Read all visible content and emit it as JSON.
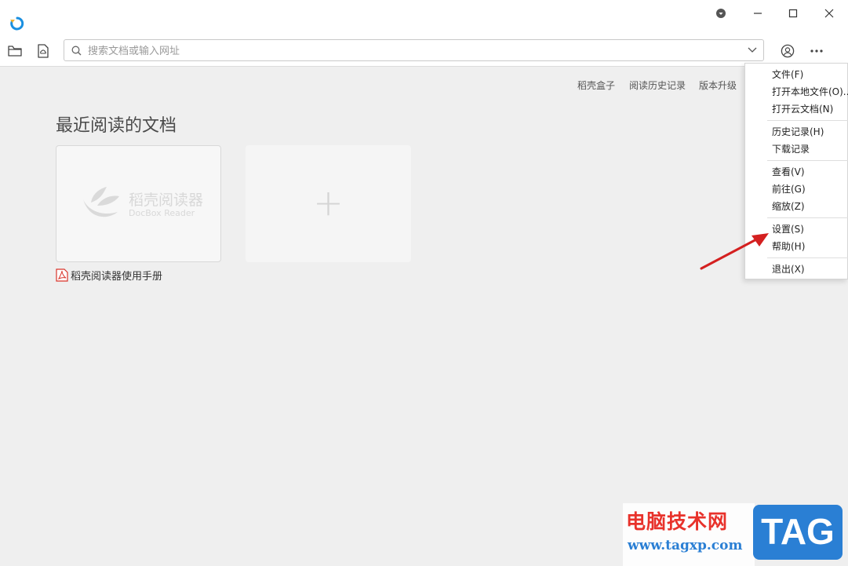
{
  "search": {
    "placeholder": "搜索文档或输入网址"
  },
  "topnav": {
    "box": "稻壳盒子",
    "history": "阅读历史记录",
    "upgrade": "版本升级"
  },
  "recent": {
    "title": "最近阅读的文档",
    "doc_logo_cn": "稻壳阅读器",
    "doc_logo_en": "DocBox Reader",
    "doc_name": "稻壳阅读器使用手册",
    "add_symbol": "+"
  },
  "menu": {
    "file": "文件(F)",
    "open_local": "打开本地文件(O)..",
    "open_cloud": "打开云文档(N)",
    "history": "历史记录(H)",
    "downloads": "下载记录",
    "view": "查看(V)",
    "goto": "前往(G)",
    "zoom": "缩放(Z)",
    "settings": "设置(S)",
    "help": "帮助(H)",
    "exit": "退出(X)"
  },
  "watermark": {
    "site_cn": "电脑技术网",
    "site_url": "www.tagxp.com",
    "tag": "TAG"
  },
  "colors": {
    "accent_blue": "#1a8fe0",
    "pdf_red": "#d9342b",
    "arrow_red": "#d42020",
    "watermark_red": "#e8322b",
    "watermark_blue": "#2a7fd4"
  }
}
